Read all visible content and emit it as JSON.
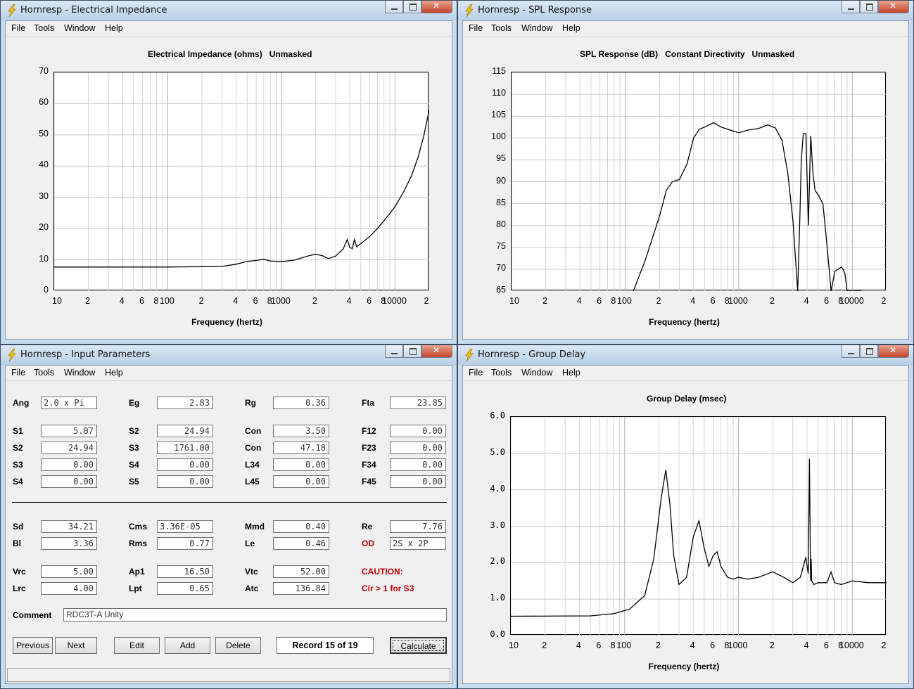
{
  "windows": {
    "impedance": {
      "title": "Hornresp - Electrical Impedance",
      "menu": [
        "File",
        "Tools",
        "Window",
        "Help"
      ],
      "plot_title": "Electrical Impedance (ohms)   Unmasked",
      "xlabel": "Frequency (hertz)"
    },
    "spl": {
      "title": "Hornresp - SPL Response",
      "menu": [
        "File",
        "Tools",
        "Window",
        "Help"
      ],
      "plot_title": "SPL Response (dB)   Constant Directivity   Unmasked",
      "xlabel": "Frequency (hertz)"
    },
    "input": {
      "title": "Hornresp - Input Parameters",
      "menu": [
        "File",
        "Tools",
        "Window",
        "Help"
      ],
      "comment_label": "Comment",
      "comment_value": "RDC3T-A Unity",
      "buttons": {
        "previous": "Previous",
        "next": "Next",
        "edit": "Edit",
        "add": "Add",
        "delete": "Delete",
        "calculate": "Calculate"
      },
      "record": "Record 15 of 19",
      "caution": "CAUTION:",
      "caution_detail": "Cir > 1 for S3"
    },
    "group_delay": {
      "title": "Hornresp - Group Delay",
      "menu": [
        "File",
        "Tools",
        "Window",
        "Help"
      ],
      "plot_title": "Group Delay (msec)",
      "xlabel": "Frequency (hertz)"
    }
  },
  "params": {
    "Ang": "2.0 x Pi",
    "Eg": "2.83",
    "Rg": "0.36",
    "Fta": "23.85",
    "S1": "5.07",
    "S2a": "24.94",
    "Con1": "3.50",
    "F12": "0.00",
    "S2b": "24.94",
    "S3a": "1761.00",
    "Con2": "47.18",
    "F23": "0.00",
    "S3b": "0.00",
    "S4a": "0.00",
    "L34": "0.00",
    "F34": "0.00",
    "S4b": "0.00",
    "S5": "0.00",
    "L45": "0.00",
    "F45": "0.00",
    "Sd": "34.21",
    "Cms": "3.36E-05",
    "Mmd": "0.40",
    "Re": "7.76",
    "Bl": "3.36",
    "Rms": "0.77",
    "Le": "0.46",
    "OD": "2S x 2P",
    "Vrc": "5.00",
    "Ap1": "16.50",
    "Vtc": "52.00",
    "Lrc": "4.00",
    "Lpt": "0.65",
    "Atc": "136.84"
  },
  "param_labels": {
    "Ang": "Ang",
    "Eg": "Eg",
    "Rg": "Rg",
    "Fta": "Fta",
    "S1": "S1",
    "S2a": "S2",
    "Con1": "Con",
    "F12": "F12",
    "S2b": "S2",
    "S3a": "S3",
    "Con2": "Con",
    "F23": "F23",
    "S3b": "S3",
    "S4a": "S4",
    "L34": "L34",
    "F34": "F34",
    "S4b": "S4",
    "S5": "S5",
    "L45": "L45",
    "F45": "F45",
    "Sd": "Sd",
    "Cms": "Cms",
    "Mmd": "Mmd",
    "Re": "Re",
    "Bl": "Bl",
    "Rms": "Rms",
    "Le": "Le",
    "OD": "OD",
    "Vrc": "Vrc",
    "Ap1": "Ap1",
    "Vtc": "Vtc",
    "Lrc": "Lrc",
    "Lpt": "Lpt",
    "Atc": "Atc"
  },
  "colors": {
    "accent_red": "#c00000",
    "plot_line": "#000000",
    "grid": "#c8c8c8"
  },
  "chart_data": [
    {
      "type": "line",
      "title": "Electrical Impedance (ohms)   Unmasked",
      "xlabel": "Frequency (hertz)",
      "xscale": "log",
      "xlim": [
        10,
        20000
      ],
      "ylim": [
        0,
        70
      ],
      "yticks": [
        0,
        10,
        20,
        30,
        40,
        50,
        60,
        70
      ],
      "xtick_labels": [
        "10",
        "2",
        "4",
        "6",
        "8",
        "100",
        "2",
        "4",
        "6",
        "8",
        "1000",
        "2",
        "4",
        "6",
        "8",
        "10000",
        "2"
      ],
      "series": [
        {
          "x": [
            10,
            50,
            100,
            200,
            300,
            400,
            500,
            600,
            700,
            800,
            1000,
            1300,
            1700,
            2000,
            2300,
            2600,
            3000,
            3500,
            3800,
            4000,
            4200,
            4400,
            4600,
            5000,
            6000,
            7000,
            8000,
            10000,
            12000,
            14000,
            16000,
            18000,
            20000
          ],
          "y": [
            7.7,
            7.7,
            7.7,
            7.8,
            7.9,
            8.6,
            9.5,
            9.8,
            10.2,
            9.6,
            9.4,
            9.9,
            11.2,
            11.8,
            11.3,
            10.4,
            11.2,
            13.5,
            16.5,
            14.0,
            13.6,
            16.5,
            14.2,
            15.2,
            17.5,
            20.0,
            22.5,
            27.0,
            32.0,
            37.0,
            43.0,
            50.0,
            58.0
          ]
        }
      ]
    },
    {
      "type": "line",
      "title": "SPL Response (dB)   Constant Directivity   Unmasked",
      "xlabel": "Frequency (hertz)",
      "xscale": "log",
      "xlim": [
        10,
        20000
      ],
      "ylim": [
        65,
        115
      ],
      "yticks": [
        65,
        70,
        75,
        80,
        85,
        90,
        95,
        100,
        105,
        110,
        115
      ],
      "xtick_labels": [
        "10",
        "2",
        "4",
        "6",
        "8",
        "100",
        "2",
        "4",
        "6",
        "8",
        "1000",
        "2",
        "4",
        "6",
        "8",
        "10000",
        "2"
      ],
      "series": [
        {
          "x": [
            118,
            150,
            200,
            230,
            260,
            300,
            350,
            400,
            450,
            500,
            600,
            700,
            800,
            1000,
            1200,
            1500,
            1800,
            2100,
            2400,
            2700,
            3000,
            3300,
            3450,
            3550,
            3700,
            3900,
            4100,
            4300,
            4350,
            4400,
            4500,
            4700,
            5000,
            5500,
            6000,
            6500,
            7000,
            7500,
            8000,
            8300,
            8600,
            9000,
            10000,
            11000,
            12000
          ],
          "y": [
            65,
            72,
            82,
            88,
            90,
            90.5,
            94,
            100,
            102,
            102.5,
            103.5,
            102.5,
            102.0,
            101.2,
            101.8,
            102.2,
            103.0,
            102.3,
            99.5,
            92.0,
            81.0,
            65.0,
            82.0,
            95.0,
            101.0,
            101.0,
            80.0,
            100.5,
            98.5,
            96.0,
            92.0,
            88.0,
            87.0,
            85.0,
            75.0,
            65.0,
            69.5,
            70.0,
            70.5,
            70.0,
            69.0,
            65.0,
            65,
            65,
            65
          ]
        }
      ]
    },
    {
      "type": "line",
      "title": "Group Delay (msec)",
      "xlabel": "Frequency (hertz)",
      "xscale": "log",
      "xlim": [
        10,
        20000
      ],
      "ylim": [
        0,
        6
      ],
      "yticks": [
        "0.0",
        "1.0",
        "2.0",
        "3.0",
        "4.0",
        "5.0",
        "6.0"
      ],
      "xtick_labels": [
        "10",
        "2",
        "4",
        "6",
        "8",
        "100",
        "2",
        "4",
        "6",
        "8",
        "1000",
        "2",
        "4",
        "6",
        "8",
        "10000",
        "2"
      ],
      "series": [
        {
          "x": [
            10,
            50,
            80,
            110,
            150,
            180,
            210,
            230,
            250,
            270,
            300,
            350,
            400,
            450,
            500,
            550,
            600,
            650,
            700,
            800,
            900,
            1000,
            1200,
            1500,
            2000,
            2500,
            3000,
            3500,
            3900,
            4100,
            4200,
            4300,
            4350,
            4400,
            4600,
            5000,
            6000,
            6500,
            7000,
            8000,
            10000,
            14000,
            20000
          ],
          "y": [
            0.53,
            0.54,
            0.6,
            0.72,
            1.1,
            2.1,
            3.8,
            4.55,
            3.6,
            2.2,
            1.4,
            1.6,
            2.7,
            3.15,
            2.4,
            1.9,
            2.2,
            2.3,
            1.9,
            1.6,
            1.55,
            1.6,
            1.55,
            1.6,
            1.75,
            1.6,
            1.45,
            1.6,
            2.15,
            1.7,
            4.85,
            1.5,
            2.1,
            1.5,
            1.4,
            1.45,
            1.45,
            1.75,
            1.45,
            1.4,
            1.5,
            1.45,
            1.45
          ]
        }
      ]
    }
  ]
}
